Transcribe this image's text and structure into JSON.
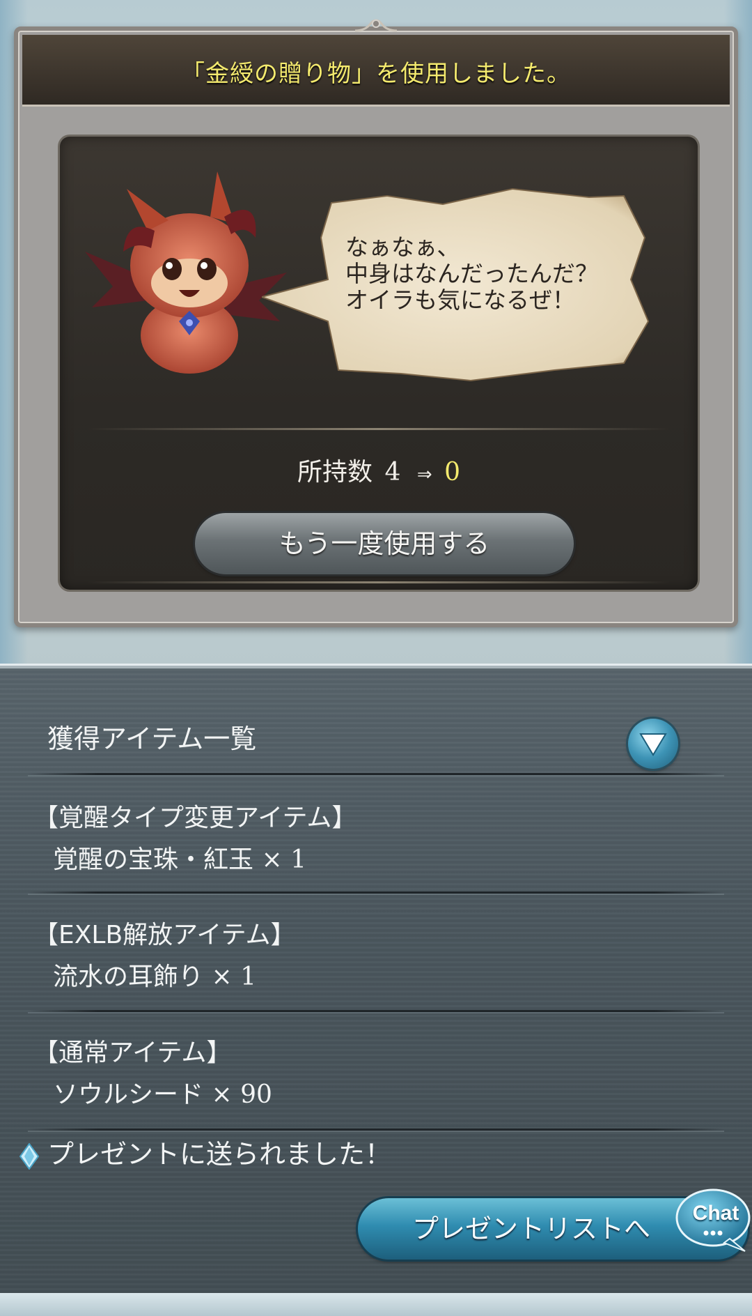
{
  "dialog": {
    "title": "「金綬の贈り物」を使用しました。",
    "speech_lines": [
      "なぁなぁ、",
      "中身はなんだったんだ？",
      "オイラも気になるぜ！"
    ],
    "count_label": "所持数",
    "count_before": "4",
    "count_arrow": "⇒",
    "count_after": "0",
    "reuse_button": "もう一度使用する"
  },
  "items_panel": {
    "heading": "獲得アイテム一覧",
    "groups": [
      {
        "category": "【覚醒タイプ変更アイテム】",
        "name": "覚醒の宝珠・紅玉",
        "qty": "× 1"
      },
      {
        "category": "【EXLB解放アイテム】",
        "name": "流水の耳飾り",
        "qty": "× 1"
      },
      {
        "category": "【通常アイテム】",
        "name": "ソウルシード",
        "qty": "× 90"
      }
    ],
    "sent_message": "プレゼントに送られました！",
    "present_button": "プレゼントリストへ",
    "chat_label": "Chat"
  },
  "colors": {
    "title_yellow": "#f4ea6e",
    "button_blue": "#2f8cb0",
    "panel_slate": "#4b575e"
  },
  "icons": [
    "chevron-down-icon",
    "diamond-icon",
    "chat-icon",
    "character-portrait"
  ]
}
